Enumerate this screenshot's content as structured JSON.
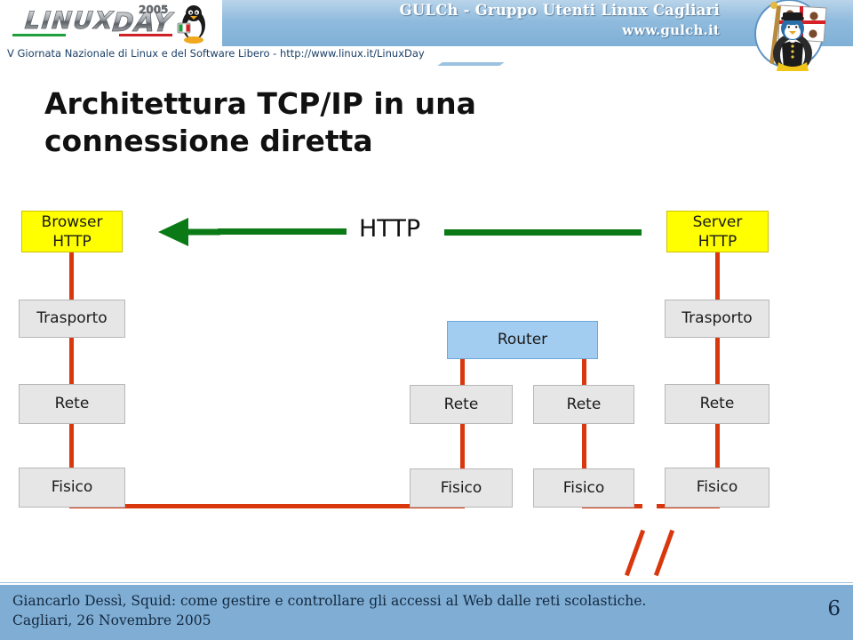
{
  "header": {
    "logo_alt": "Linux Day 2005",
    "logo_word1": "LINUX",
    "logo_word2": "DAY",
    "logo_year": "2005",
    "org_title": "GULCh - Gruppo Utenti Linux Cagliari",
    "org_url": "www.gulch.it",
    "subbanner": "V Giornata Nazionale di Linux e del Software Libero  -  http://www.linux.it/LinuxDay",
    "mascot_alt": "GULCh penguin with Sardinian flag"
  },
  "slide": {
    "title_line1": "Architettura TCP/IP in una",
    "title_line2": "connessione diretta"
  },
  "diagram": {
    "protocol_label": "HTTP",
    "client_stack": [
      {
        "label": "Browser\nHTTP",
        "style": "yellow"
      },
      {
        "label": "Trasporto",
        "style": "grey"
      },
      {
        "label": "Rete",
        "style": "grey"
      },
      {
        "label": "Fisico",
        "style": "grey"
      }
    ],
    "router": {
      "label": "Router",
      "style": "blue"
    },
    "router_stack_left": [
      {
        "label": "Rete",
        "style": "grey"
      },
      {
        "label": "Fisico",
        "style": "grey"
      }
    ],
    "router_stack_right": [
      {
        "label": "Rete",
        "style": "grey"
      },
      {
        "label": "Fisico",
        "style": "grey"
      }
    ],
    "server_stack": [
      {
        "label": "Server\nHTTP",
        "style": "yellow"
      },
      {
        "label": "Trasporto",
        "style": "grey"
      },
      {
        "label": "Rete",
        "style": "grey"
      },
      {
        "label": "Fisico",
        "style": "grey"
      }
    ],
    "break_symbol": "//",
    "colors": {
      "link_red": "#d9380f",
      "arrow_green": "#0b7a16",
      "yellow_box": "#ffff00",
      "grey_box": "#e6e6e6",
      "blue_box": "#a3cdf0"
    }
  },
  "footer": {
    "line1": "Giancarlo Dessì, Squid: come gestire e controllare gli accessi al Web dalle reti scolastiche.",
    "line2": "Cagliari, 26 Novembre 2005",
    "page_number": "6"
  }
}
